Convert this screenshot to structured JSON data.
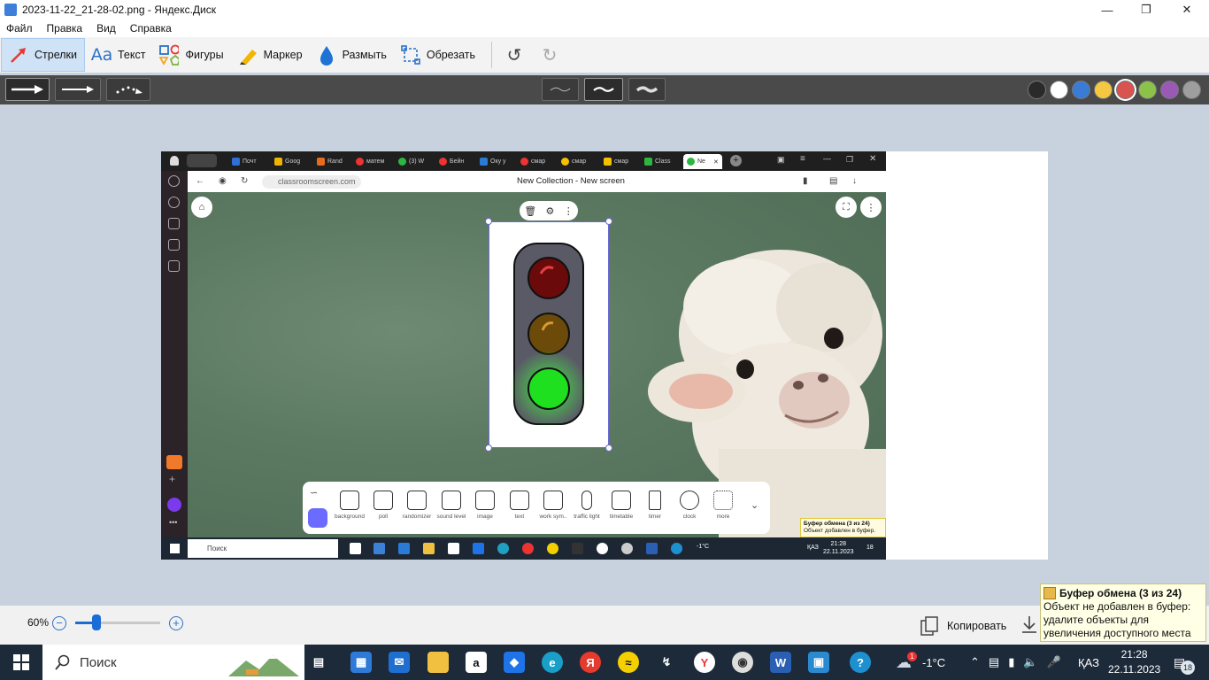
{
  "window": {
    "title": "2023-11-22_21-28-02.png - Яндекс.Диск"
  },
  "menu": [
    "Файл",
    "Правка",
    "Вид",
    "Справка"
  ],
  "tools": [
    {
      "label": "Стрелки",
      "active": true
    },
    {
      "label": "Текст"
    },
    {
      "label": "Фигуры"
    },
    {
      "label": "Маркер"
    },
    {
      "label": "Размыть"
    },
    {
      "label": "Обрезать"
    }
  ],
  "icons": {
    "undo": "undo-icon",
    "redo": "redo-icon"
  },
  "options": {
    "arrow_styles": [
      "arrow-bold",
      "arrow-thin",
      "arrow-dotted"
    ],
    "stroke_widths": [
      "thin",
      "medium",
      "thick"
    ],
    "selected_stroke": 1,
    "colors": [
      "#2a2a2a",
      "#ffffff",
      "#3a7bd5",
      "#f5c842",
      "#d9534f",
      "#8bc34a",
      "#9b59b6",
      "#9e9e9e"
    ],
    "selected_color": 4
  },
  "browser": {
    "tabs": [
      "Почт",
      "Goog",
      "Rand",
      "матем",
      "(3) W",
      "Бейн",
      "Оку у",
      "смар",
      "смар",
      "смар",
      "Class",
      "Ne"
    ],
    "url": "classroomscreen.com",
    "page_title": "New Collection - New screen",
    "dock": [
      "background",
      "poll",
      "randomizer",
      "sound level",
      "image",
      "text",
      "work sym..",
      "traffic light",
      "timetable",
      "timer",
      "clock",
      "more"
    ],
    "notif_title": "Буфер обмена (3 из 24)",
    "notif_text": "Объект добавлен в буфер.",
    "search": "Поиск",
    "weather": "-1°C",
    "lang": "ҚАЗ",
    "time": "21:28",
    "date": "22.11.2023",
    "notif_count": "18"
  },
  "status": {
    "zoom": "60%",
    "zoom_level": 0.25,
    "copy_label": "Копировать"
  },
  "toast": {
    "title": "Буфер обмена (3 из 24)",
    "body": "Объект не добавлен в буфер: удалите объекты для увеличения доступного места"
  },
  "taskbar": {
    "search": "Поиск",
    "weather": "-1°C",
    "weather_badge": "1",
    "lang": "ҚАЗ",
    "time": "21:28",
    "date": "22.11.2023",
    "notif_count": "18"
  }
}
